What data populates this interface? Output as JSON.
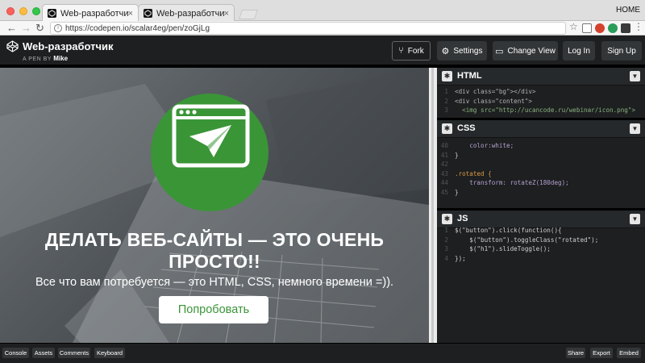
{
  "browser": {
    "tabs": [
      {
        "title": "Web-разработчик",
        "close": "×"
      },
      {
        "title": "Web-разработчик",
        "close": "×"
      }
    ],
    "profile_label": "HOME",
    "url": "https://codepen.io/scalar4eg/pen/zoGjLg"
  },
  "codepen": {
    "pen_title": "Web-разработчик",
    "by_prefix": "A PEN BY",
    "author": "Mike",
    "buttons": {
      "fork": "Fork",
      "settings": "Settings",
      "change_view": "Change View",
      "login": "Log In",
      "signup": "Sign Up"
    }
  },
  "preview": {
    "heading": "ДЕЛАТЬ ВЕБ-САЙТЫ — ЭТО ОЧЕНЬ ПРОСТО!!",
    "subtext": "Все что вам потребуется — это HTML, CSS, немного времени =)).",
    "button_label": "Попробовать"
  },
  "editors": [
    {
      "title": "HTML",
      "lines": [
        {
          "n": "1",
          "text": "<div class=\"bg\"></div>"
        },
        {
          "n": "2",
          "text": "<div class=\"content\">"
        },
        {
          "n": "3",
          "text": "  <img src=\"http://ucancode.ru/webinar/icon.png\">"
        }
      ]
    },
    {
      "title": "CSS",
      "lines": [
        {
          "n": "40",
          "text": "    color:white;"
        },
        {
          "n": "41",
          "text": "}"
        },
        {
          "n": "42",
          "text": ""
        },
        {
          "n": "43",
          "text": ".rotated {"
        },
        {
          "n": "44",
          "text": "    transform: rotateZ(180deg);"
        },
        {
          "n": "45",
          "text": "}"
        }
      ]
    },
    {
      "title": "JS",
      "lines": [
        {
          "n": "1",
          "text": "$(\"button\").click(function(){"
        },
        {
          "n": "2",
          "text": "    $(\"button\").toggleClass(\"rotated\");"
        },
        {
          "n": "3",
          "text": "    $(\"h1\").slideToggle();"
        },
        {
          "n": "4",
          "text": "});"
        }
      ]
    }
  ],
  "footer": {
    "left": [
      "Console",
      "Assets",
      "Comments",
      "Keyboard"
    ],
    "right": [
      "Share",
      "Export",
      "Embed"
    ]
  },
  "colors": {
    "brand_green": "#3a9537",
    "header_bg": "#1d1f20",
    "editor_bg": "#1d1f20"
  }
}
